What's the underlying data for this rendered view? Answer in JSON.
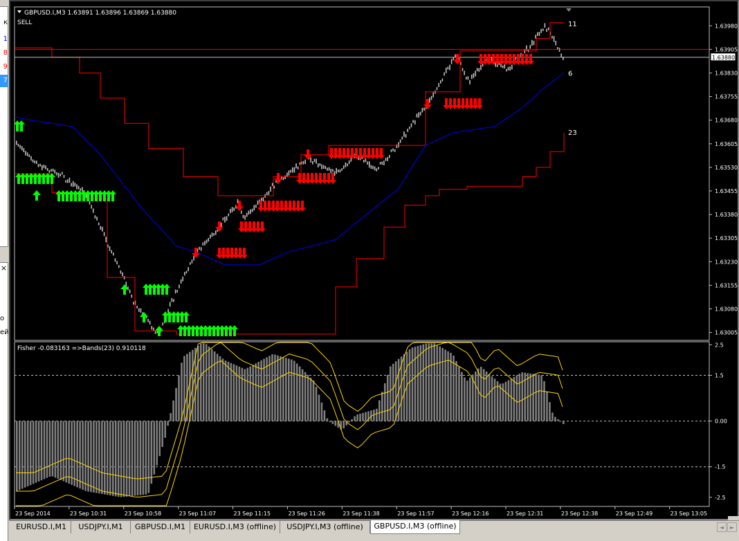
{
  "navigator": {
    "header_char": "к",
    "rows": [
      {
        "text": "1",
        "color": "#0000ff"
      },
      {
        "text": "8",
        "color": "#ff0000"
      },
      {
        "text": "9",
        "color": "#ff0000"
      },
      {
        "text": "7",
        "color": "#ffffff",
        "bg": "#3399ff"
      }
    ],
    "close_glyph": "×",
    "lower_texts": [
      "о",
      "ей"
    ]
  },
  "chart": {
    "title": "GBPUSD.I,M3  1.63891 1.63896 1.63869 1.63880",
    "signal_label": "SELL",
    "symbol": "GBPUSD.I,M3",
    "ohlc": "1.63891 1.63896 1.63869 1.63880",
    "current_price": "1.63880",
    "price_ticks": [
      "1.63980",
      "1.63905",
      "1.63830",
      "1.63755",
      "1.63680",
      "1.63605",
      "1.63530",
      "1.63455",
      "1.63380",
      "1.63305",
      "1.63230",
      "1.63155",
      "1.63080",
      "1.63005"
    ],
    "price_range": [
      1.6298,
      1.6404
    ],
    "channel_labels": {
      "upper": "11",
      "middle": "6",
      "lower": "23"
    },
    "indicator_title": "Fisher -0.083163  =>Bands(23) 0.910118",
    "indicator_ticks": [
      "2.5",
      "1.5",
      "0.00",
      "-1.5",
      "-2.5"
    ],
    "indicator_range": [
      -2.8,
      2.6
    ],
    "indicator_levels": [
      1.5,
      0.0,
      -1.5
    ],
    "time_labels": [
      "23 Sep 2014",
      "23 Sep 10:31",
      "23 Sep 10:58",
      "23 Sep 11:07",
      "23 Sep 11:15",
      "23 Sep 11:26",
      "23 Sep 11:38",
      "23 Sep 11:57",
      "23 Sep 12:16",
      "23 Sep 12:31",
      "23 Sep 12:38",
      "23 Sep 12:49",
      "23 Sep 13:05"
    ],
    "colors": {
      "background": "#000000",
      "grid": "#c0c0c0",
      "bars": "#c0c0c0",
      "upper_band": "#ff0000",
      "middle_band": "#0000ff",
      "lower_band": "#ff0000",
      "buy_signal": "#00ff00",
      "sell_signal": "#ff0000",
      "fisher_histogram": "#808080",
      "fisher_bands": "#ffd700",
      "price_tag_bg": "#ffffff"
    }
  },
  "tabs": [
    {
      "label": "EURUSD.I,M1",
      "active": false
    },
    {
      "label": "USDJPY.I,M1",
      "active": false
    },
    {
      "label": "GBPUSD.I,M1",
      "active": false
    },
    {
      "label": "EURUSD.I,M3 (offline)",
      "active": false
    },
    {
      "label": "USDJPY.I,M3 (offline)",
      "active": false
    },
    {
      "label": "GBPUSD.I,M3 (offline)",
      "active": true
    }
  ],
  "tab_scroll": {
    "left": "◄",
    "right": "►"
  }
}
